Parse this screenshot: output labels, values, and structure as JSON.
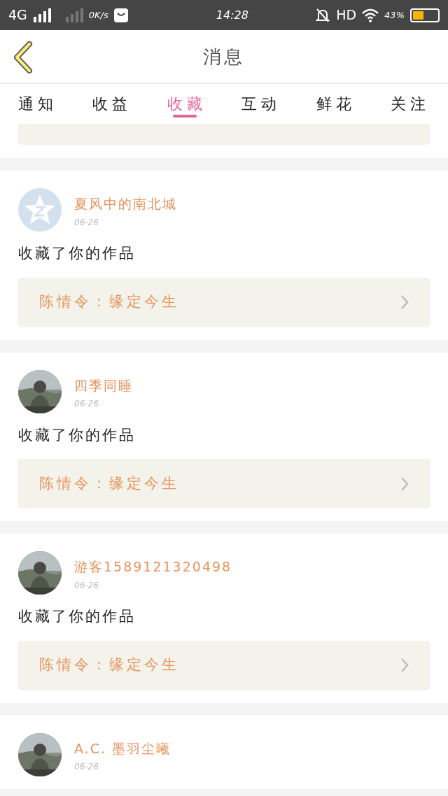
{
  "status_bar": {
    "network": "4G",
    "speed": "0K/s",
    "time": "14:28",
    "hd": "HD",
    "battery": "43%"
  },
  "header": {
    "title": "消息"
  },
  "tabs": [
    {
      "label": "通知",
      "selected": false
    },
    {
      "label": "收益",
      "selected": false
    },
    {
      "label": "收藏",
      "selected": true
    },
    {
      "label": "互动",
      "selected": false
    },
    {
      "label": "鲜花",
      "selected": false
    },
    {
      "label": "关注",
      "selected": false
    }
  ],
  "messages": [
    {
      "kind": "default",
      "name": "夏风中的南北城",
      "date": "06-26",
      "text": "收藏了你的作品",
      "work": "陈情令：缘定今生"
    },
    {
      "kind": "picture",
      "name": "四季同睡",
      "date": "06-26",
      "text": "收藏了你的作品",
      "work": "陈情令：缘定今生"
    },
    {
      "kind": "picture",
      "name": "游客1589121320498",
      "date": "06-26",
      "text": "收藏了你的作品",
      "work": "陈情令：缘定今生"
    },
    {
      "kind": "picture",
      "name": "A.C. 墨羽尘曦",
      "date": "06-26"
    }
  ]
}
